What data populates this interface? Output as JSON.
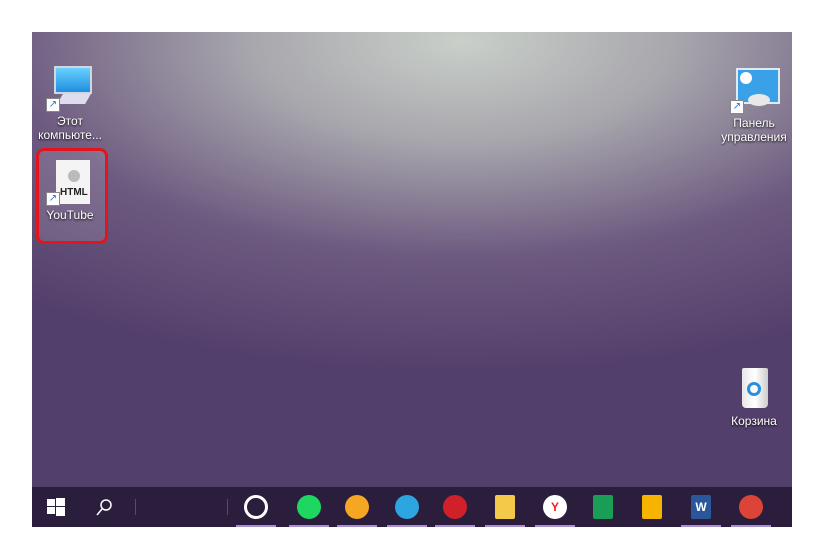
{
  "desktop": {
    "icons": [
      {
        "label_line1": "Этот",
        "label_line2": "компьюте...",
        "icon": "computer-icon"
      },
      {
        "label": "YouTube",
        "badge": "HTML",
        "icon": "html-file-icon",
        "selected": true
      },
      {
        "label_line1": "Панель",
        "label_line2": "управления",
        "icon": "control-panel-icon"
      },
      {
        "label": "Корзина",
        "icon": "recycle-bin-icon"
      }
    ]
  },
  "taskbar": {
    "start": "windows-start-icon",
    "search": "search-icon",
    "apps": [
      {
        "name": "opera-like-app",
        "color": "#ffffff",
        "running": true
      },
      {
        "name": "spotify",
        "color": "#1ed760",
        "running": true
      },
      {
        "name": "music-player",
        "color": "#f5a623",
        "running": true
      },
      {
        "name": "telegram",
        "color": "#2ca5e0",
        "running": true
      },
      {
        "name": "red-app",
        "color": "#d0202a",
        "running": true
      },
      {
        "name": "file-explorer",
        "color": "#f3c94a",
        "running": true
      },
      {
        "name": "yandex-browser",
        "color": "#ffffff",
        "running": true
      },
      {
        "name": "google-sheets",
        "color": "#1a9e57",
        "running": false
      },
      {
        "name": "google-keep",
        "color": "#f6b400",
        "running": false
      },
      {
        "name": "microsoft-word",
        "color": "#2b579a",
        "running": true
      },
      {
        "name": "google-chrome",
        "color": "#db4437",
        "running": true
      }
    ],
    "word_letter": "W"
  }
}
